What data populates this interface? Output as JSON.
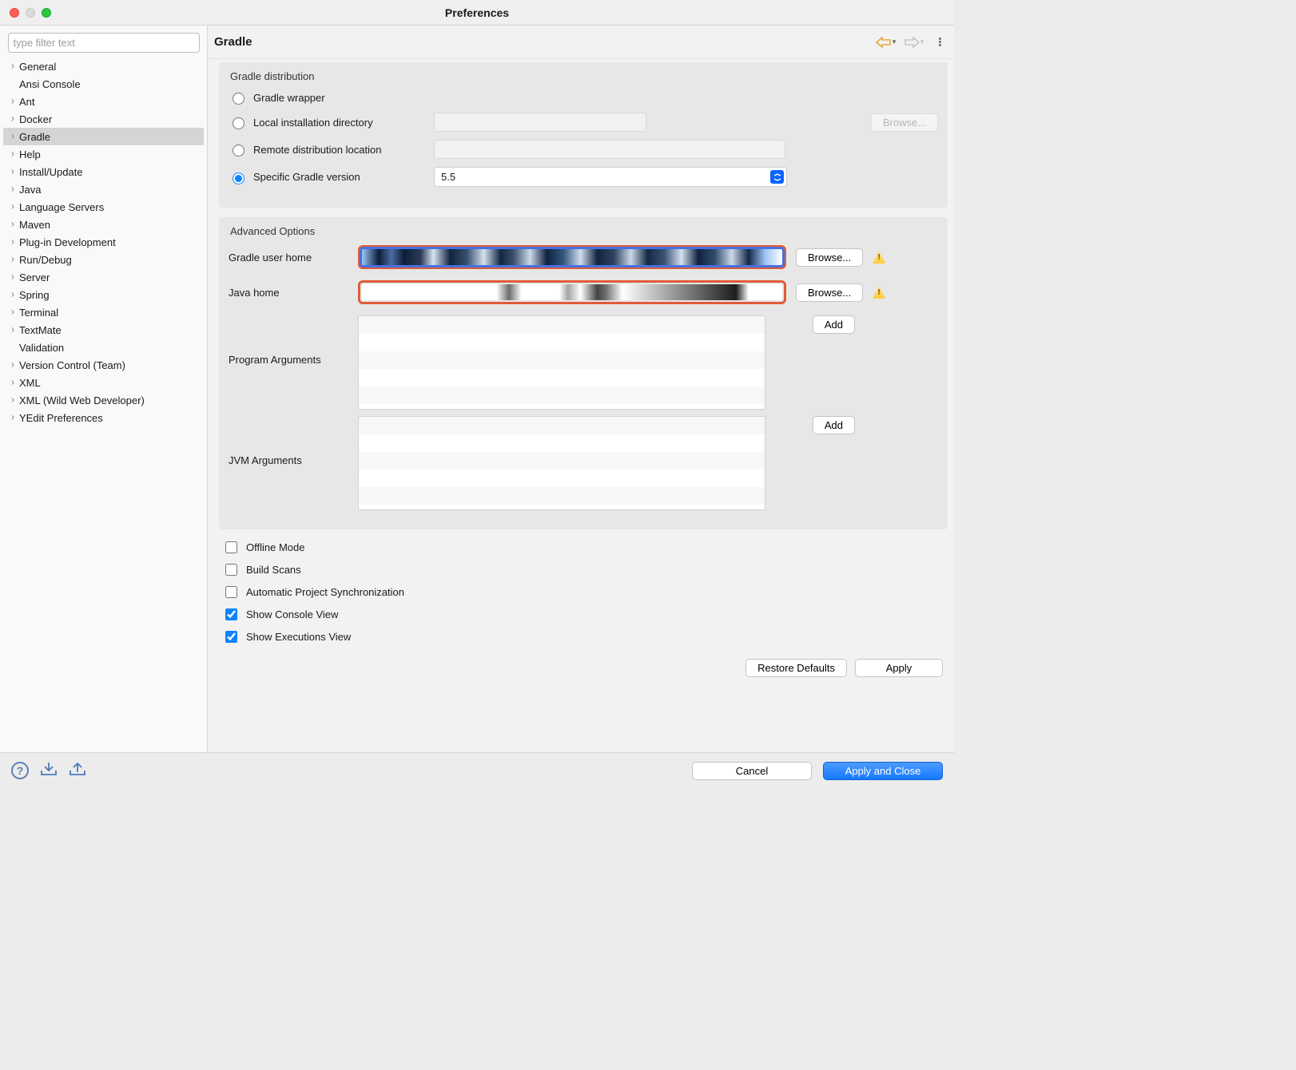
{
  "window": {
    "title": "Preferences"
  },
  "sidebar": {
    "filter_placeholder": "type filter text",
    "items": [
      {
        "label": "General",
        "expandable": true
      },
      {
        "label": "Ansi Console",
        "expandable": false
      },
      {
        "label": "Ant",
        "expandable": true
      },
      {
        "label": "Docker",
        "expandable": true
      },
      {
        "label": "Gradle",
        "expandable": true,
        "selected": true
      },
      {
        "label": "Help",
        "expandable": true
      },
      {
        "label": "Install/Update",
        "expandable": true
      },
      {
        "label": "Java",
        "expandable": true
      },
      {
        "label": "Language Servers",
        "expandable": true
      },
      {
        "label": "Maven",
        "expandable": true
      },
      {
        "label": "Plug-in Development",
        "expandable": true
      },
      {
        "label": "Run/Debug",
        "expandable": true
      },
      {
        "label": "Server",
        "expandable": true
      },
      {
        "label": "Spring",
        "expandable": true
      },
      {
        "label": "Terminal",
        "expandable": true
      },
      {
        "label": "TextMate",
        "expandable": true
      },
      {
        "label": "Validation",
        "expandable": false
      },
      {
        "label": "Version Control (Team)",
        "expandable": true
      },
      {
        "label": "XML",
        "expandable": true
      },
      {
        "label": "XML (Wild Web Developer)",
        "expandable": true
      },
      {
        "label": "YEdit Preferences",
        "expandable": true
      }
    ]
  },
  "page": {
    "title": "Gradle",
    "distribution": {
      "title": "Gradle distribution",
      "options": {
        "wrapper": "Gradle wrapper",
        "local_dir": "Local installation directory",
        "remote": "Remote distribution location",
        "specific": "Specific Gradle version"
      },
      "selected": "specific",
      "version_value": "5.5",
      "browse_label": "Browse..."
    },
    "advanced": {
      "title": "Advanced Options",
      "gradle_user_home_label": "Gradle user home",
      "java_home_label": "Java home",
      "browse_label": "Browse...",
      "program_args_label": "Program Arguments",
      "jvm_args_label": "JVM Arguments",
      "add_label": "Add"
    },
    "checkboxes": {
      "offline": {
        "label": "Offline Mode",
        "checked": false
      },
      "scans": {
        "label": "Build Scans",
        "checked": false
      },
      "autosync": {
        "label": "Automatic Project Synchronization",
        "checked": false
      },
      "console": {
        "label": "Show Console View",
        "checked": true
      },
      "executions": {
        "label": "Show Executions View",
        "checked": true
      }
    },
    "buttons": {
      "restore": "Restore Defaults",
      "apply": "Apply",
      "cancel": "Cancel",
      "apply_close": "Apply and Close"
    }
  }
}
